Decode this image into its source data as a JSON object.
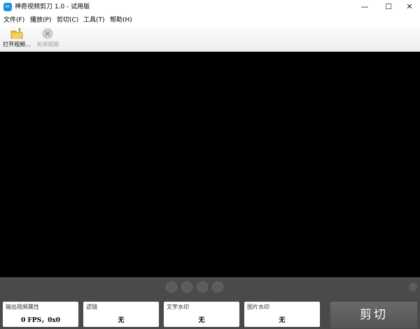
{
  "window": {
    "title": "神奇视频剪刀 1.0 - 试用版",
    "minimize_glyph": "—",
    "maximize_glyph": "☐",
    "close_glyph": "✕"
  },
  "menu": {
    "items": [
      "文件(F)",
      "播放(P)",
      "剪切(C)",
      "工具(T)",
      "帮助(H)"
    ]
  },
  "toolbar": {
    "open_label": "打开视频...",
    "close_label": "关闭视频"
  },
  "panels": {
    "output": {
      "label": "输出视频属性",
      "value": "0 FPS，0x0"
    },
    "filter": {
      "label": "滤镜",
      "value": "无"
    },
    "text_watermark": {
      "label": "文字水印",
      "value": "无"
    },
    "image_watermark": {
      "label": "图片水印",
      "value": "无"
    }
  },
  "cut_button": {
    "label": "剪切"
  },
  "icons": {
    "app": "scissors-app-icon",
    "open": "open-folder-icon",
    "close": "close-video-icon",
    "controls": [
      "play-icon",
      "rewind-icon",
      "pause-icon",
      "stop-icon"
    ]
  },
  "colors": {
    "video_bg": "#000000",
    "bottom_panel": "#4a4a4a",
    "accent": "#1a8fe0"
  }
}
